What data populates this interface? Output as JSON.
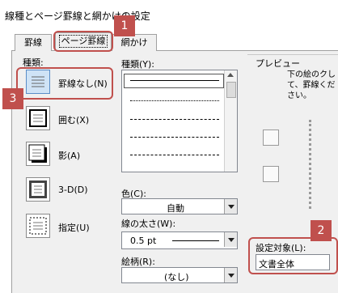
{
  "window": {
    "title": "線種とページ罫線と網かけの設定"
  },
  "tabs": [
    {
      "label": "罫線"
    },
    {
      "label": "ページ罫線"
    },
    {
      "label": "網かけ"
    }
  ],
  "presets": {
    "heading": "種類:",
    "items": [
      {
        "label": "罫線なし(N)"
      },
      {
        "label": "囲む(X)"
      },
      {
        "label": "影(A)"
      },
      {
        "label": "3-D(D)"
      },
      {
        "label": "指定(U)"
      }
    ]
  },
  "style": {
    "heading": "種類(Y):"
  },
  "color": {
    "label": "色(C):",
    "value": "自動"
  },
  "width": {
    "label": "線の太さ(W):",
    "value": "0.5 pt"
  },
  "art": {
    "label": "絵柄(R):",
    "value": "(なし)"
  },
  "preview": {
    "heading": "プレビュー",
    "text": "下の絵のクして、罫線ください。"
  },
  "apply": {
    "label": "設定対象(L):",
    "value": "文書全体"
  },
  "callouts": [
    {
      "num": "1"
    },
    {
      "num": "2"
    },
    {
      "num": "3"
    }
  ]
}
